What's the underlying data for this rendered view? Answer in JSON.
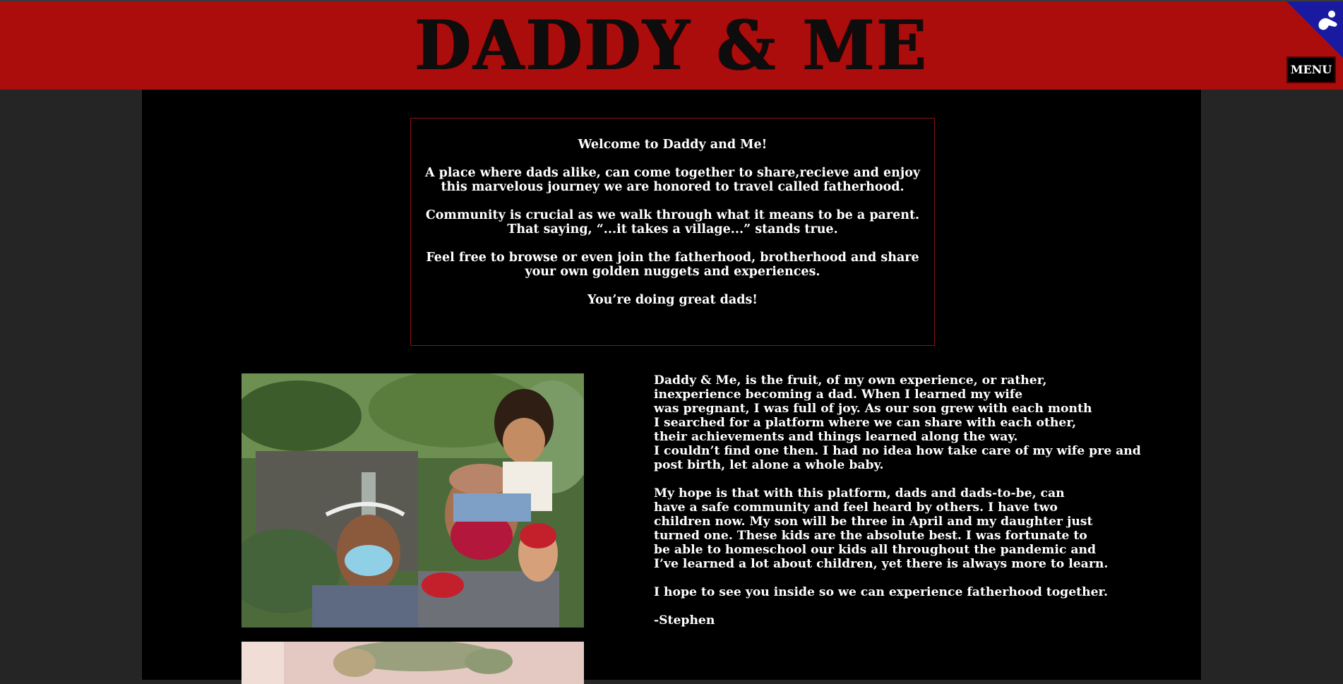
{
  "header": {
    "title": "DADDY & ME",
    "menu_label": "MENU",
    "badge_icon": "accessibility-icon",
    "colors": {
      "banner": "#ab0d0d",
      "badge": "#1a1aa0"
    }
  },
  "welcome": {
    "heading": "Welcome to Daddy and Me!",
    "para1_line1": "A place where dads alike, can come together to share,recieve and enjoy",
    "para1_line2": "this marvelous journey we are honored to travel called fatherhood.",
    "para2_line1": "Community is crucial as we walk through what it means to be a parent.",
    "para2_line2": "That saying, “...it takes a village...” stands true.",
    "para3_line1": "Feel free to browse or even join the fatherhood, brotherhood and share",
    "para3_line2": "your own golden nuggets and experiences.",
    "closing": "You’re doing great dads!"
  },
  "story": {
    "p1": [
      "Daddy & Me, is the fruit, of my own experience, or rather,",
      "inexperience becoming a dad. When I learned my wife",
      "was pregnant, I was full of joy. As our son grew with each month",
      "I searched for a platform where we can share with each other,",
      "their achievements and things learned along the way.",
      "I couldn’t find one then. I had no idea how take care of my wife pre and",
      "post birth, let alone a whole baby."
    ],
    "p2": [
      "My hope is that with this platform, dads and dads-to-be, can",
      "have a safe community and feel heard by others. I have two",
      "children now. My son will be three in April and my daughter just",
      "turned one. These kids are the absolute best. I was fortunate to",
      "be able to homeschool our kids all throughout the pandemic and",
      "I’ve learned a lot about children, yet there is always more to learn."
    ],
    "p3": "I hope to see you inside so we can experience fatherhood together.",
    "signature": "-Stephen"
  }
}
